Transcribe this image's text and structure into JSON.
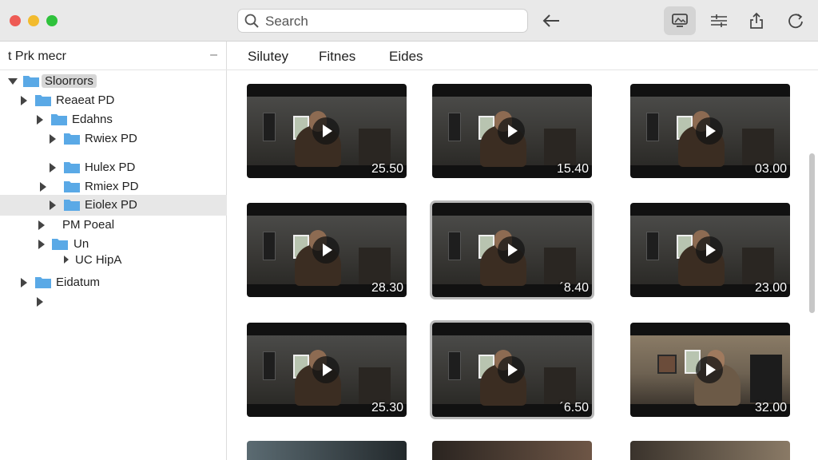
{
  "toolbar": {
    "search_placeholder": "Search",
    "back_icon": "arrow-left-icon",
    "buttons": [
      "photo-monitor-icon",
      "filter-lines-icon",
      "share-icon",
      "refresh-icon"
    ]
  },
  "sidebar": {
    "title": "t Prk mecr",
    "collapse_label": "–",
    "items": [
      {
        "label": "Sloorrors",
        "expanded": true
      },
      {
        "label": "Reaeat PD",
        "expanded": false
      },
      {
        "label": "Edahns",
        "expanded": false
      },
      {
        "label": "Rwiex PD",
        "expanded": false
      },
      {
        "label": "Hulex PD",
        "expanded": false
      },
      {
        "label": "Rmiex PD",
        "expanded": false
      },
      {
        "label": "Eiolex PD",
        "expanded": false,
        "selected": true
      },
      {
        "label": "PM Poeal",
        "expanded": false
      },
      {
        "label": "Un",
        "expanded": false
      },
      {
        "label": "UC HipA",
        "expanded": false
      },
      {
        "label": "Eidatum",
        "expanded": false
      },
      {
        "label": "",
        "expanded": false
      }
    ]
  },
  "main": {
    "tabs": [
      "Silutey",
      "Fitnes",
      "Eides"
    ],
    "videos": [
      {
        "duration": "25.50"
      },
      {
        "duration": "15.40"
      },
      {
        "duration": "03.00"
      },
      {
        "duration": "28.30"
      },
      {
        "duration": "´8.40",
        "selected": true
      },
      {
        "duration": "23.00"
      },
      {
        "duration": "25.30"
      },
      {
        "duration": "´6.50",
        "selected": true
      },
      {
        "duration": "32.00",
        "bright": true
      }
    ]
  },
  "colors": {
    "close": "#ee5b55",
    "minimize": "#f2bb2e",
    "zoom": "#2fc23c",
    "folder": "#5aa9e6"
  }
}
